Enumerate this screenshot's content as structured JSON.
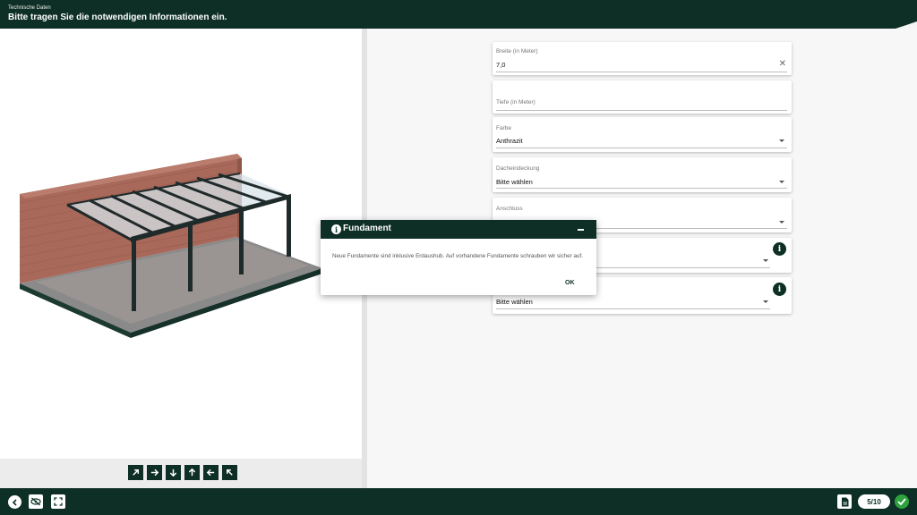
{
  "header": {
    "subtitle": "Technische Daten",
    "title": "Bitte tragen Sie die notwendigen Informationen ein."
  },
  "viewer": {
    "nav_icons": [
      "arrow-up-right-icon",
      "arrow-right-icon",
      "arrow-down-icon",
      "arrow-up-icon",
      "arrow-left-icon",
      "arrow-up-left-icon"
    ]
  },
  "form": {
    "breite": {
      "label": "Breite (in Meter)",
      "value": "7,0"
    },
    "tiefe": {
      "label": "Tiefe (in Meter)",
      "value": ""
    },
    "farbe": {
      "label": "Farbe",
      "value": "Anthrazit"
    },
    "dacheindeckung": {
      "label": "Dacheindeckung",
      "value": "Bitte wählen"
    },
    "anschluss": {
      "label": "Anschluss",
      "value": ""
    },
    "fundament": {
      "label": "",
      "value": ""
    },
    "last": {
      "label": "",
      "value": "Bitte wählen"
    }
  },
  "modal": {
    "title": "Fundament",
    "body": "Neue Fundamente sind inklusive Erdaushub. Auf vorhandene Fundamente schrauben wir sicher auf.",
    "ok_label": "OK"
  },
  "footer": {
    "page_indicator": "5/10"
  },
  "colors": {
    "brand": "#0e2f25",
    "success": "#2ea23e",
    "brick": "#a8695a",
    "frame": "#1f2a2a"
  }
}
